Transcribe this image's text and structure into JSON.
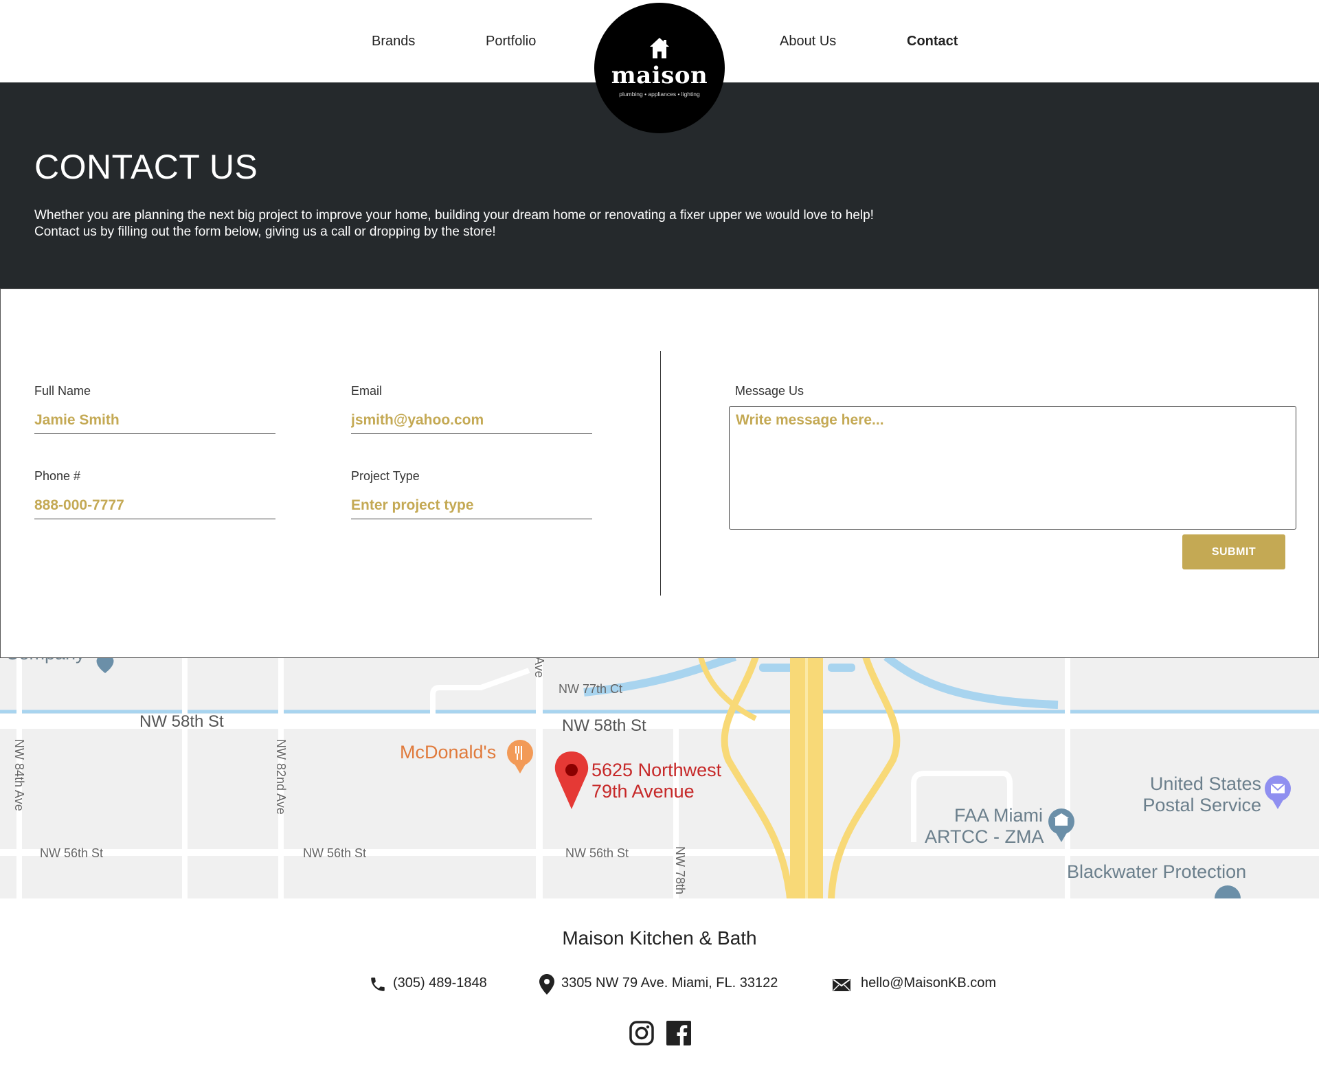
{
  "nav": {
    "items": [
      {
        "label": "Brands"
      },
      {
        "label": "Portfolio"
      },
      {
        "label": "About Us"
      },
      {
        "label": "Contact"
      }
    ]
  },
  "logo": {
    "wordmark": "maison",
    "tagline": "plumbing • appliances • lighting"
  },
  "hero": {
    "title": "CONTACT US",
    "intro_line1": "Whether you are planning the next big project to improve your home, building your dream home or renovating a fixer upper we would love to help!",
    "intro_line2": "Contact us by filling out the form below, giving us a call or dropping by the store!"
  },
  "form": {
    "full_name": {
      "label": "Full Name",
      "value": "Jamie Smith"
    },
    "email": {
      "label": "Email",
      "value": "jsmith@yahoo.com"
    },
    "phone": {
      "label": "Phone #",
      "value": "888-000-7777"
    },
    "project_type": {
      "label": "Project Type",
      "placeholder": "Enter project type"
    },
    "message": {
      "label": "Message Us",
      "placeholder": "Write message here..."
    },
    "submit_label": "SUBMIT",
    "accent_color": "#c4a954"
  },
  "map": {
    "streets": {
      "nw_58th_left": "NW 58th St",
      "nw_58th_right": "NW 58th St",
      "nw_77th_ct": "NW 77th Ct",
      "nw_56th_a": "NW 56th St",
      "nw_56th_b": "NW 56th St",
      "nw_56th_c": "NW 56th St",
      "nw_84th_ave": "NW 84th Ave",
      "nw_82nd_ave": "NW 82nd Ave",
      "nw_78th": "NW 78th",
      "ave_fragment": "Ave"
    },
    "pois": {
      "company_fragment": "Company",
      "mcdonalds": "McDonald's",
      "pin_address_line1": "5625 Northwest",
      "pin_address_line2": "79th Avenue",
      "faa_line1": "FAA Miami",
      "faa_line2": "ARTCC - ZMA",
      "usps_line1": "United States",
      "usps_line2": "Postal Service",
      "blackwater": "Blackwater Protection"
    }
  },
  "footer": {
    "title": "Maison Kitchen & Bath",
    "phone": "(305) 489-1848",
    "address": "3305 NW 79 Ave. Miami, FL. 33122",
    "email": "hello@MaisonKB.com",
    "social": [
      "instagram-icon",
      "facebook-icon"
    ]
  },
  "colors": {
    "hero_bg": "#25292c",
    "gold": "#c4a954",
    "map_pin": "#e53935",
    "pin_text": "#c62828"
  }
}
